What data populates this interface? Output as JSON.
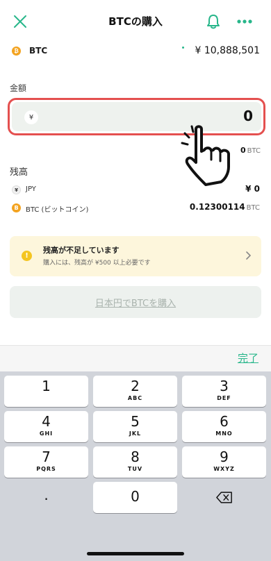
{
  "header": {
    "title": "BTCの購入"
  },
  "price": {
    "symbol": "BTC",
    "value": "¥ 10,888,501"
  },
  "amount": {
    "label": "金額",
    "currency_symbol": "¥",
    "value": "0",
    "btc_value": "0",
    "btc_unit": "BTC"
  },
  "balance": {
    "label": "残高",
    "rows": [
      {
        "coin": "¥",
        "name": "JPY",
        "amount": "¥ 0",
        "unit": ""
      },
      {
        "coin": "B",
        "name": "BTC (ビットコイン)",
        "amount": "0.12300114",
        "unit": "BTC"
      }
    ]
  },
  "warning": {
    "title": "残高が不足しています",
    "subtitle": "購入には、残高が ¥500 以上必要です"
  },
  "buy_button": {
    "label": "日本円でBTCを購入"
  },
  "keyboard": {
    "done": "完了",
    "keys": [
      {
        "num": "1",
        "letters": ""
      },
      {
        "num": "2",
        "letters": "ABC"
      },
      {
        "num": "3",
        "letters": "DEF"
      },
      {
        "num": "4",
        "letters": "GHI"
      },
      {
        "num": "5",
        "letters": "JKL"
      },
      {
        "num": "6",
        "letters": "MNO"
      },
      {
        "num": "7",
        "letters": "PQRS"
      },
      {
        "num": "8",
        "letters": "TUV"
      },
      {
        "num": "9",
        "letters": "WXYZ"
      },
      {
        "num": ".",
        "letters": ""
      },
      {
        "num": "0",
        "letters": ""
      }
    ]
  },
  "colors": {
    "accent": "#27b68a",
    "highlight": "#e4504f",
    "btc": "#f3a320",
    "warning_bg": "#fdf6dc"
  },
  "icons": [
    "close-icon",
    "bell-icon",
    "more-icon",
    "btc-coin-icon",
    "yen-coin-icon",
    "warning-icon",
    "chevron-right-icon",
    "backspace-icon",
    "pointing-hand-icon"
  ]
}
